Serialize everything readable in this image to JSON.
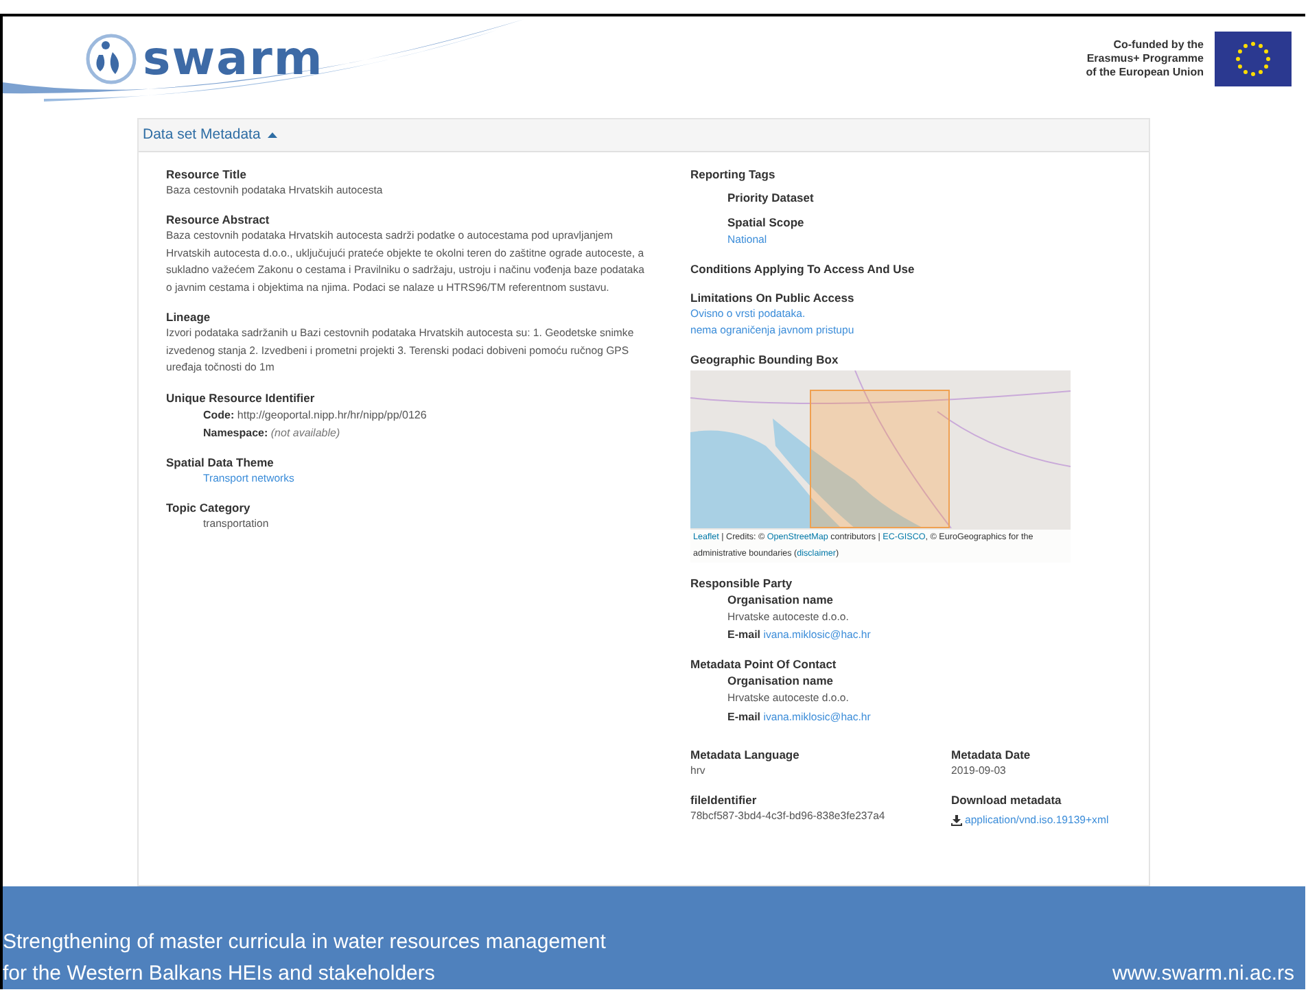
{
  "header": {
    "logo_text": "swarm",
    "cofunded_lines": [
      "Co-funded by the",
      "Erasmus+ Programme",
      "of the European Union"
    ]
  },
  "panel": {
    "title": "Data set Metadata",
    "expanded": true,
    "left": [
      {
        "kind": "text",
        "label": "Resource Title",
        "value": "Baza cestovnih podataka Hrvatskih autocesta"
      },
      {
        "kind": "text",
        "label": "Resource Abstract",
        "value": "Baza cestovnih podataka Hrvatskih autocesta sadrži podatke o autocestama pod upravljanjem Hrvatskih autocesta d.o.o., uključujući prateće objekte te okolni teren do zaštitne ograde autoceste, a sukladno važećem Zakonu o cestama i Pravilniku o sadržaju, ustroju i načinu vođenja baze podataka o javnim cestama i objektima na njima. Podaci se nalaze u HTRS96/TM referentnom sustavu."
      },
      {
        "kind": "text",
        "label": "Lineage",
        "value": "Izvori podataka sadržanih u Bazi cestovnih podataka Hrvatskih autocesta su: 1. Geodetske snimke izvedenog stanja 2. Izvedbeni i prometni projekti 3. Terenski podaci dobiveni pomoću ručnog GPS uređaja točnosti do 1m"
      },
      {
        "kind": "pairs",
        "label": "Unique Resource Identifier",
        "pairs": [
          {
            "key": "Code:",
            "value": "http://geoportal.nipp.hr/hr/nipp/pp/0126",
            "kind": "plain"
          },
          {
            "key": "Namespace:",
            "value": "(not available)",
            "kind": "missing"
          }
        ]
      },
      {
        "kind": "indented-link",
        "label": "Spatial Data Theme",
        "value": "Transport networks"
      },
      {
        "kind": "indented-text",
        "label": "Topic Category",
        "value": "transportation"
      }
    ],
    "right": [
      {
        "kind": "subsections",
        "label": "Reporting Tags",
        "items": [
          {
            "label": "Priority Dataset"
          },
          {
            "label": "Spatial Scope",
            "links": [
              "National"
            ]
          }
        ]
      },
      {
        "kind": "heading",
        "label": "Conditions Applying To Access And Use"
      },
      {
        "kind": "links",
        "label": "Limitations On Public Access",
        "links": [
          "Ovisno o vrsti podataka.",
          "nema ograničenja javnom pristupu"
        ]
      },
      {
        "kind": "map",
        "label": "Geographic Bounding Box",
        "attribution": [
          {
            "text": "Leaflet",
            "kind": "link"
          },
          {
            "text": " | Credits: © ",
            "kind": "text"
          },
          {
            "text": "OpenStreetMap",
            "kind": "link"
          },
          {
            "text": " contributors | ",
            "kind": "text"
          },
          {
            "text": "EC-GISCO",
            "kind": "link"
          },
          {
            "text": ", © EuroGeographics for the administrative boundaries (",
            "kind": "text"
          },
          {
            "text": "disclaimer",
            "kind": "link"
          },
          {
            "text": ")",
            "kind": "text"
          }
        ]
      },
      {
        "kind": "contact",
        "label": "Responsible Party",
        "org_label": "Organisation name",
        "org": "Hrvatske autoceste d.o.o.",
        "email_label": "E-mail",
        "email": "ivana.miklosic@hac.hr"
      },
      {
        "kind": "contact",
        "label": "Metadata Point Of Contact",
        "org_label": "Organisation name",
        "org": "Hrvatske autoceste d.o.o.",
        "email_label": "E-mail",
        "email": "ivana.miklosic@hac.hr"
      },
      {
        "kind": "grid",
        "cells": [
          {
            "label": "Metadata Language",
            "value": "hrv",
            "kind": "text"
          },
          {
            "label": "Metadata Date",
            "value": "2019-09-03",
            "kind": "text"
          },
          {
            "label": "fileIdentifier",
            "value": "78bcf587-3bd4-4c3f-bd96-838e3fe237a4",
            "kind": "text"
          },
          {
            "label": "Download metadata",
            "value": "application/vnd.iso.19139+xml",
            "kind": "download"
          }
        ]
      }
    ]
  },
  "footer": {
    "lines": [
      "Strengthening of master curricula in water resources management",
      "for the Western Balkans HEIs and stakeholders"
    ],
    "url": "www.swarm.ni.ac.rs"
  }
}
